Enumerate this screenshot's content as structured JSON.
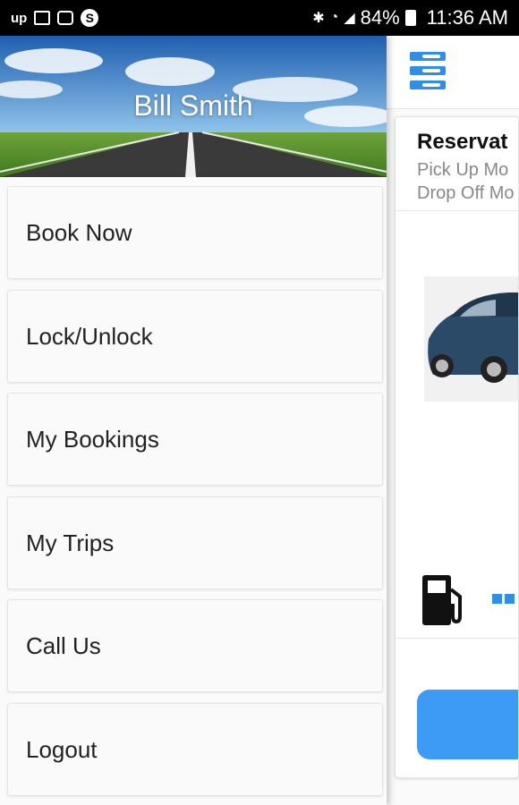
{
  "status_bar": {
    "left_icons": [
      "up-icon",
      "image-icon",
      "camera-icon",
      "skype-icon"
    ],
    "bluetooth_icon": "bluetooth-icon",
    "wifi_icon": "wifi-icon",
    "signal_icon": "signal-icon",
    "battery_percent": "84%",
    "time": "11:36 AM"
  },
  "drawer": {
    "user_name": "Bill Smith",
    "items": [
      {
        "label": "Book Now"
      },
      {
        "label": "Lock/Unlock"
      },
      {
        "label": "My Bookings"
      },
      {
        "label": "My Trips"
      },
      {
        "label": "Call Us"
      },
      {
        "label": "Logout"
      }
    ]
  },
  "background": {
    "menu_icon": "hamburger-icon",
    "card": {
      "title": "Reservat",
      "pickup": "Pick Up Mo",
      "dropoff": "Drop Off Mo"
    },
    "fuel_icon": "fuel-pump-icon",
    "accent_color": "#2f8fe6"
  }
}
